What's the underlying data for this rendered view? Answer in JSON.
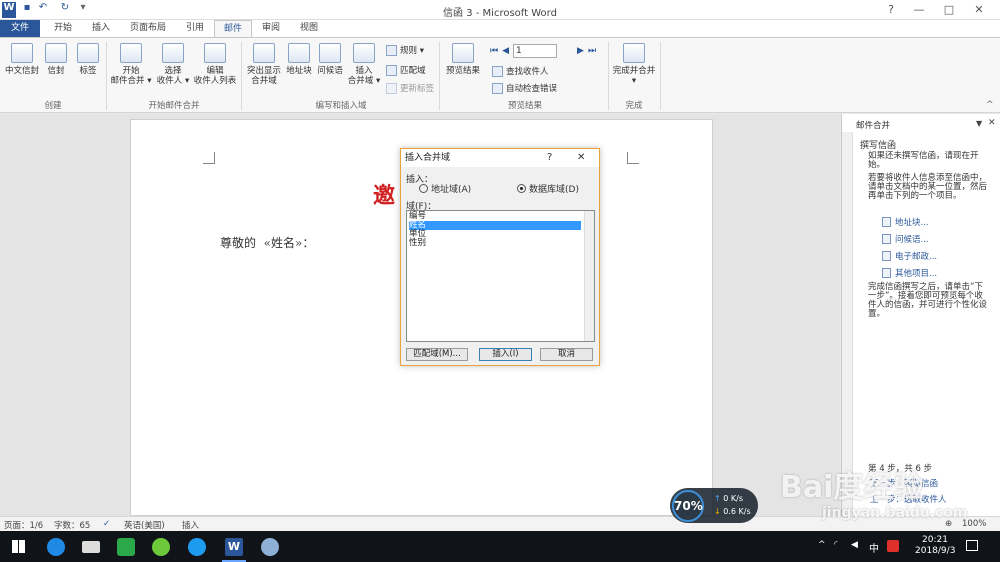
{
  "window": {
    "title": "信函 3 - Microsoft Word",
    "qat_icons": [
      "word-logo-icon",
      "save-icon",
      "undo-icon",
      "redo-icon",
      "customize-icon"
    ],
    "controls": {
      "help": "?",
      "restore": "▢",
      "minimize": "—",
      "maximize": "□",
      "close": "✕"
    }
  },
  "tabs": [
    "文件",
    "开始",
    "插入",
    "页面布局",
    "引用",
    "邮件",
    "审阅",
    "视图"
  ],
  "active_tab": "邮件",
  "ribbon": {
    "groups": {
      "create": "创建",
      "start_merge": "开始邮件合并",
      "write_insert": "编写和插入域",
      "preview": "预览结果",
      "finish": "完成"
    },
    "buttons": {
      "chinese_envelope": "中文信封",
      "envelope": "信封",
      "labels": "标签",
      "start_merge_1": "开始",
      "start_merge_2": "邮件合并 ▾",
      "select_1": "选择",
      "select_2": "收件人 ▾",
      "edit_1": "编辑",
      "edit_2": "收件人列表",
      "highlight_1": "突出显示",
      "highlight_2": "合并域",
      "address_block": "地址块",
      "greeting_line": "问候语",
      "insert_1": "插入",
      "insert_2": "合并域 ▾",
      "rules": "规则 ▾",
      "match_fields": "匹配域",
      "update_labels": "更新标签",
      "preview_results": "预览结果",
      "record_number": "1",
      "find_recipient": "查找收件人",
      "auto_check": "自动检查错误",
      "finish_1": "完成并合并",
      "finish_2": "▾"
    }
  },
  "document": {
    "greeting": "尊敬的  «姓名»：",
    "red_fragment": "邀"
  },
  "dialog": {
    "title": "插入合并域",
    "help": "?",
    "close": "✕",
    "insert_label": "插入：",
    "option_address": "地址域(A)",
    "option_database": "数据库域(D)",
    "fields_label": "域(F)：",
    "fields": [
      "编号",
      "姓名",
      "单位",
      "性别"
    ],
    "selected_field": "姓名",
    "btn_match": "匹配域(M)...",
    "btn_insert": "插入(I)",
    "btn_cancel": "取消"
  },
  "pane": {
    "title": "邮件合并",
    "section": "撰写信函",
    "p1": "如果还未撰写信函，请现在开始。",
    "p2": "若要将收件人信息添至信函中，请单击文档中的某一位置，然后再单击下列的一个项目。",
    "links": [
      "地址块...",
      "问候语...",
      "电子邮政...",
      "其他项目..."
    ],
    "p3": "完成信函撰写之后，请单击“下一步”。接着您即可预览每个收件人的信函，并可进行个性化设置。",
    "step": "第 4 步，共 6 步",
    "next": "下一步：预览信函",
    "prev": "上一步：选取收件人"
  },
  "status": {
    "page": "页面：1/6",
    "words": "字数：65",
    "language": "英语(美国)",
    "mode": "插入",
    "zoom": "100%"
  },
  "network": {
    "percent": "70%",
    "up": "0 K/s",
    "down": "0.6 K/s"
  },
  "taskbar": {
    "ime": "中",
    "time": "20:21",
    "date": "2018/9/3"
  },
  "watermark": {
    "brand": "Bai度经验",
    "url": "jingyan.baidu.com"
  }
}
